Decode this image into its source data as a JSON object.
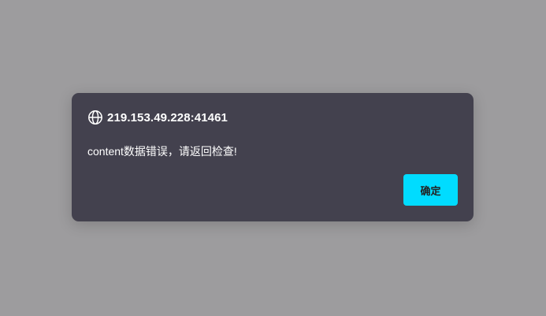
{
  "dialog": {
    "title": "219.153.49.228:41461",
    "message": "content数据错误，请返回检查!",
    "confirm_label": "确定",
    "icon": "globe-icon"
  },
  "colors": {
    "backdrop": "#9d9c9e",
    "dialog_bg": "#43414e",
    "accent": "#00dcff",
    "text": "#ffffff"
  }
}
